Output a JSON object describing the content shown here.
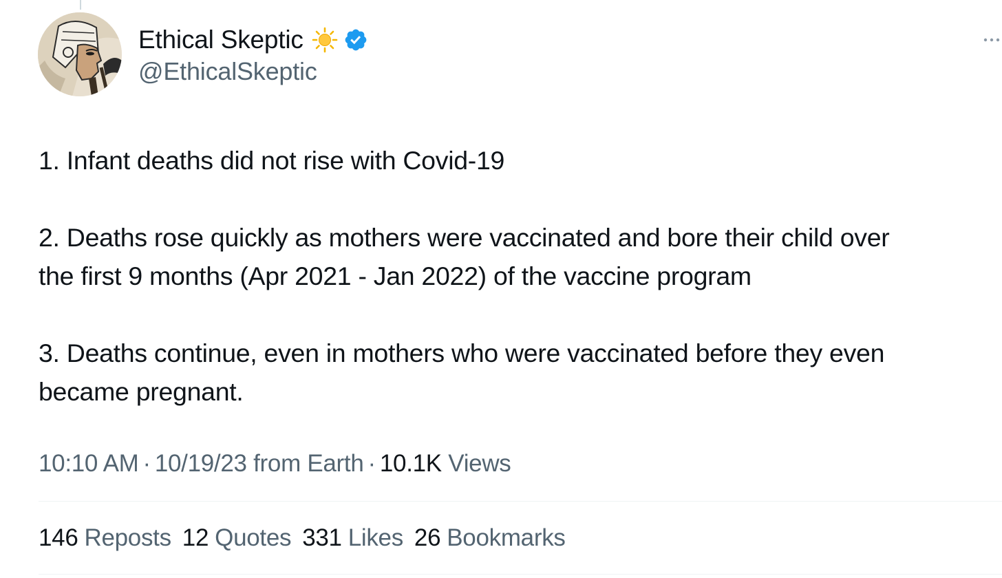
{
  "author": {
    "display_name": "Ethical Skeptic",
    "handle": "@EthicalSkeptic",
    "badges": [
      "sun-icon",
      "verified-icon"
    ]
  },
  "tweet": {
    "paragraphs": [
      "1.  Infant deaths did not rise with Covid-19",
      "2. Deaths rose quickly as mothers were vaccinated and bore their child over\nthe first 9 months (Apr 2021 - Jan 2022) of the vaccine program",
      "3. Deaths continue, even in mothers who were vaccinated before they even\nbecame pregnant."
    ]
  },
  "meta": {
    "time": "10:10 AM",
    "separator": "·",
    "date": "10/19/23",
    "location": "from Earth",
    "views_count": "10.1K",
    "views_label": "Views"
  },
  "stats": [
    {
      "count": "146",
      "label": "Reposts"
    },
    {
      "count": "12",
      "label": "Quotes"
    },
    {
      "count": "331",
      "label": "Likes"
    },
    {
      "count": "26",
      "label": "Bookmarks"
    }
  ],
  "colors": {
    "text_primary": "#0f1419",
    "text_secondary": "#536471",
    "verified_blue": "#1d9bf0",
    "sun_yellow": "#f4c430",
    "divider": "#eff3f4"
  },
  "icons": {
    "more": "more-horizontal-icon"
  }
}
